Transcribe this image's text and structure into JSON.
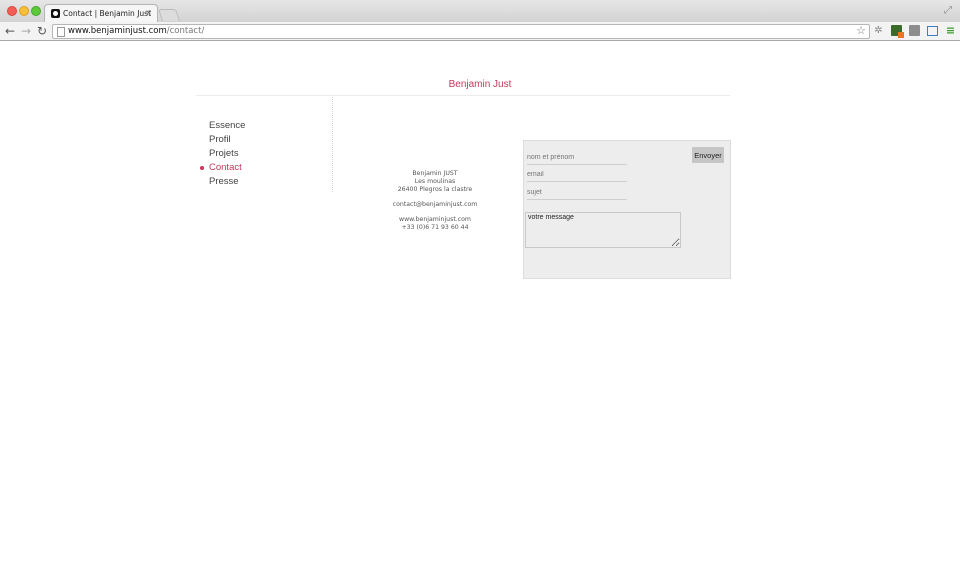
{
  "browser": {
    "tab_title": "Contact | Benjamin Just",
    "tab_close": "×",
    "url_domain": "www.benjaminjust.com",
    "url_path": "/contact/"
  },
  "site": {
    "title": "Benjamin Just"
  },
  "nav": {
    "items": [
      {
        "label": "Essence"
      },
      {
        "label": "Profil"
      },
      {
        "label": "Projets"
      },
      {
        "label": "Contact"
      },
      {
        "label": "Presse"
      }
    ],
    "active_index": 3
  },
  "contact": {
    "name": "Benjamin JUST",
    "address_line1": "Les moulinas",
    "address_line2": "26400 Plegros la clastre",
    "email": "contact@benjaminjust.com",
    "website": "www.benjaminjust.com",
    "phone": "+33 (0)6 71 93 60 44"
  },
  "form": {
    "name_placeholder": "nom et prénom",
    "email_placeholder": "email",
    "subject_placeholder": "sujet",
    "message_value": "votre message",
    "submit_label": "Envoyer"
  },
  "colors": {
    "accent": "#c8375b",
    "form_bg": "#ecedec"
  }
}
